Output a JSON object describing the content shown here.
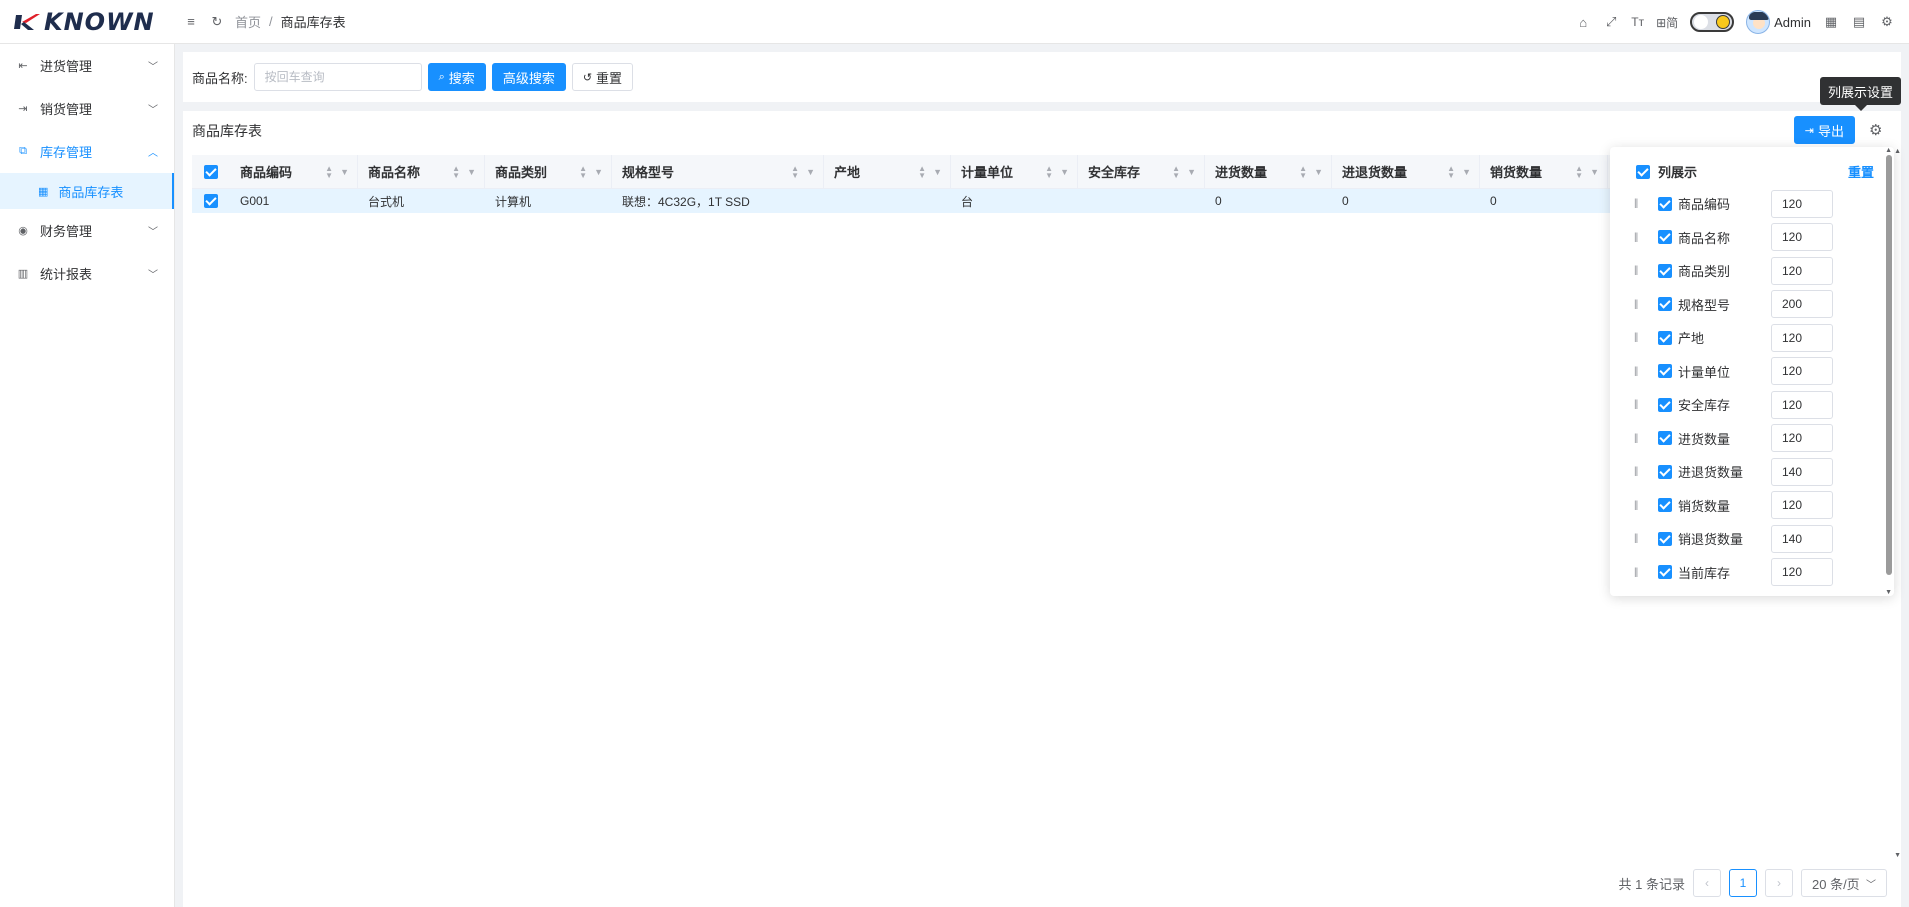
{
  "app": {
    "logo_text": "KNOWN"
  },
  "header": {
    "breadcrumb_home": "首页",
    "breadcrumb_sep": "/",
    "breadcrumb_current": "商品库存表",
    "lang_label": "简",
    "font_icon_label": "Tт",
    "user_name": "Admin"
  },
  "sidebar": {
    "items": [
      {
        "label": "进货管理",
        "icon": "import-icon",
        "expanded": false
      },
      {
        "label": "销货管理",
        "icon": "export-icon",
        "expanded": false
      },
      {
        "label": "库存管理",
        "icon": "inventory-icon",
        "expanded": true,
        "active": true
      },
      {
        "label": "财务管理",
        "icon": "finance-icon",
        "expanded": false
      },
      {
        "label": "统计报表",
        "icon": "chart-icon",
        "expanded": false
      }
    ],
    "subitem": {
      "label": "商品库存表",
      "icon": "table-icon"
    }
  },
  "search": {
    "label": "商品名称:",
    "placeholder": "按回车查询",
    "value": "",
    "search_label": "搜索",
    "advanced_label": "高级搜索",
    "reset_label": "重置"
  },
  "panel": {
    "title": "商品库存表",
    "export_label": "导出",
    "tooltip": "列展示设置"
  },
  "table": {
    "columns": [
      {
        "label": "商品编码"
      },
      {
        "label": "商品名称"
      },
      {
        "label": "商品类别"
      },
      {
        "label": "规格型号"
      },
      {
        "label": "产地"
      },
      {
        "label": "计量单位"
      },
      {
        "label": "安全库存"
      },
      {
        "label": "进货数量"
      },
      {
        "label": "进退货数量"
      },
      {
        "label": "销货数量"
      }
    ],
    "rows": [
      [
        "G001",
        "台式机",
        "计算机",
        "联想：4C32G，1T SSD",
        "",
        "台",
        "",
        "0",
        "0",
        "0"
      ]
    ]
  },
  "column_settings": {
    "header_label": "列展示",
    "reset_label": "重置",
    "items": [
      {
        "name": "商品编码",
        "width": "120"
      },
      {
        "name": "商品名称",
        "width": "120"
      },
      {
        "name": "商品类别",
        "width": "120"
      },
      {
        "name": "规格型号",
        "width": "200"
      },
      {
        "name": "产地",
        "width": "120"
      },
      {
        "name": "计量单位",
        "width": "120"
      },
      {
        "name": "安全库存",
        "width": "120"
      },
      {
        "name": "进货数量",
        "width": "120"
      },
      {
        "name": "进退货数量",
        "width": "140"
      },
      {
        "name": "销货数量",
        "width": "120"
      },
      {
        "name": "销退货数量",
        "width": "140"
      },
      {
        "name": "当前库存",
        "width": "120"
      }
    ]
  },
  "pagination": {
    "total_text": "共 1 条记录",
    "current_page": "1",
    "page_size": "20 条/页"
  },
  "colors": {
    "primary": "#1890ff",
    "row_selected": "#e6f4ff",
    "tooltip_bg": "#303133"
  }
}
